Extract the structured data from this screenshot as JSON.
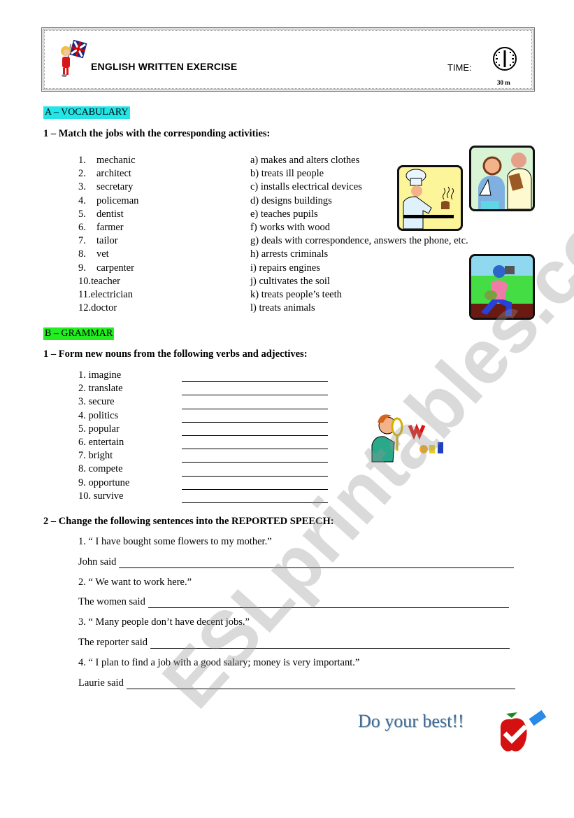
{
  "header": {
    "title": "ENGLISH WRITTEN EXERCISE",
    "time_label": "TIME:",
    "time_value": "30 m"
  },
  "section_a": {
    "label": "A – VOCABULARY",
    "question": "1 – Match the jobs with the corresponding activities:",
    "jobs": [
      {
        "num": "1.",
        "text": "mechanic"
      },
      {
        "num": "2.",
        "text": "architect"
      },
      {
        "num": "3.",
        "text": "secretary"
      },
      {
        "num": "4.",
        "text": "policeman"
      },
      {
        "num": "5.",
        "text": "dentist"
      },
      {
        "num": "6.",
        "text": "farmer"
      },
      {
        "num": "7.",
        "text": "tailor"
      },
      {
        "num": "8.",
        "text": "vet"
      },
      {
        "num": "9.",
        "text": "carpenter"
      },
      {
        "num": "10.",
        "text": "teacher"
      },
      {
        "num": "11.",
        "text": "electrician"
      },
      {
        "num": "12.",
        "text": "doctor"
      }
    ],
    "activities": [
      "a) makes and alters clothes",
      "b) treats ill people",
      "c) installs electrical devices",
      "d) designs buildings",
      "e) teaches pupils",
      "f) works with wood",
      "g) deals with correspondence, answers the phone, etc.",
      "h) arrests criminals",
      "i) repairs engines",
      "j) cultivates the soil",
      "k) treats people’s teeth",
      "l) treats animals"
    ]
  },
  "section_b": {
    "label": "B – GRAMMAR",
    "question1": "1 – Form new nouns from the following verbs and adjectives:",
    "words": [
      "1. imagine",
      "2. translate",
      "3. secure",
      "4. politics",
      "5. popular",
      "6. entertain",
      "7. bright",
      "8. compete",
      "9. opportune",
      "10. survive"
    ],
    "question2": "2 – Change the following sentences into the REPORTED SPEECH:",
    "sentences": [
      {
        "quote": "1. “ I have bought some flowers to my mother.”",
        "prompt": "John said"
      },
      {
        "quote": "2. “ We want to work here.”",
        "prompt": "The women said"
      },
      {
        "quote": "3. “ Many people don’t have decent jobs.”",
        "prompt": "The reporter said"
      },
      {
        "quote": "4. “ I plan to find a job with a good salary; money is very important.”",
        "prompt": "Laurie said"
      }
    ]
  },
  "footer": {
    "motto": "Do your best!!"
  },
  "watermark": "ESLprintables.com"
}
